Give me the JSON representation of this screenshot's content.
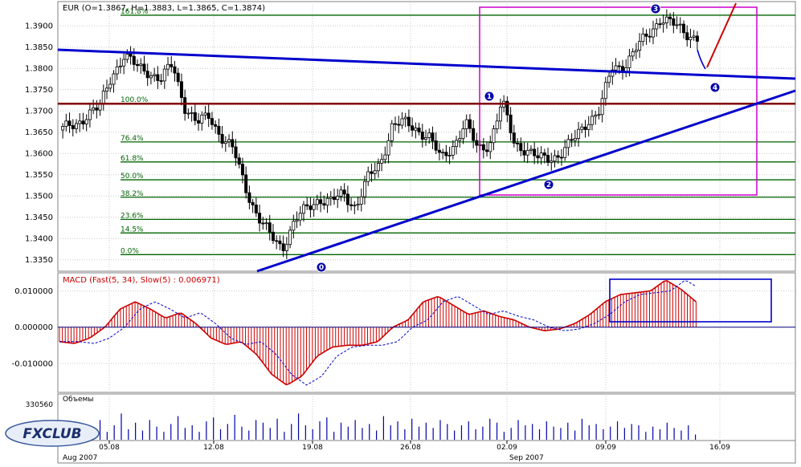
{
  "colors": {
    "background": "#ffffff",
    "grid": "#c8c8c8",
    "candle_body_up": "#ffffff",
    "candle_body_down": "#000000",
    "candle_outline": "#000000",
    "trendline": "#0000cc",
    "resistance": "#800000",
    "fibonacci": "#006400",
    "highlight_box": "#cc00cc",
    "macd_hist": "#cc0000",
    "macd_line": "#cc0000",
    "macd_signal": "#0000cc",
    "macd_box": "#0000cc",
    "volume": "#0000aa",
    "arrow_up": "#cc0000",
    "arrow_down": "#0000cc",
    "point_marker": "#0000aa"
  },
  "main_panel": {
    "title": "EUR (O=1.3867, H=1.3883, L=1.3865, C=1.3874)"
  },
  "macd_panel": {
    "title": "MACD (Fast(5, 34), Slow(5) : 0.006971)"
  },
  "volume_panel": {
    "title": "Объемы",
    "max_label": "330560"
  },
  "logo": {
    "text": "FXCLUB"
  },
  "x_axis": {
    "month_labels": [
      "Aug 2007",
      "Sep 2007"
    ],
    "date_labels": [
      "05.08",
      "12.08",
      "19.08",
      "26.08",
      "02.09",
      "09.09",
      "16.09"
    ]
  },
  "chart_data": [
    {
      "type": "candlestick",
      "title": "EUR (O=1.3867, H=1.3883, L=1.3865, C=1.3874)",
      "y_tick_labels": [
        "1.3350",
        "1.3400",
        "1.3450",
        "1.3500",
        "1.3550",
        "1.3600",
        "1.3650",
        "1.3700",
        "1.3750",
        "1.3800",
        "1.3850",
        "1.3900"
      ],
      "ylim": [
        1.3323,
        1.3957
      ],
      "grid": true,
      "x_labels": [
        "05.08",
        "12.08",
        "19.08",
        "26.08",
        "02.09",
        "09.09",
        "16.09"
      ],
      "price_path": [
        1.3655,
        1.3668,
        1.3692,
        1.3705,
        1.3785,
        1.3828,
        1.3805,
        1.3795,
        1.377,
        1.381,
        1.3712,
        1.3668,
        1.369,
        1.364,
        1.3605,
        1.352,
        1.345,
        1.3405,
        1.338,
        1.344,
        1.347,
        1.3495,
        1.3485,
        1.3505,
        1.3475,
        1.354,
        1.3575,
        1.3668,
        1.367,
        1.3658,
        1.364,
        1.3585,
        1.362,
        1.367,
        1.361,
        1.3625,
        1.372,
        1.3625,
        1.361,
        1.3585,
        1.359,
        1.3605,
        1.3635,
        1.3678,
        1.37,
        1.38,
        1.3808,
        1.3845,
        1.388,
        1.392,
        1.3902,
        1.3885,
        1.3872
      ],
      "fibonacci_levels": [
        {
          "label": "161.8%",
          "value": 1.3925
        },
        {
          "label": "100.0%",
          "value": 1.3717
        },
        {
          "label": "76.4%",
          "value": 1.3627
        },
        {
          "label": "61.8%",
          "value": 1.358
        },
        {
          "label": "50.0%",
          "value": 1.3538
        },
        {
          "label": "38.2%",
          "value": 1.3497
        },
        {
          "label": "23.6%",
          "value": 1.3445
        },
        {
          "label": "14.5%",
          "value": 1.3413
        },
        {
          "label": "0.0%",
          "value": 1.3362
        }
      ],
      "resistance_level": 1.3717,
      "wave_points": [
        "0",
        "1",
        "2",
        "3",
        "4"
      ]
    },
    {
      "type": "bar",
      "title": "MACD (Fast(5, 34), Slow(5) : 0.006971)",
      "y_tick_labels": [
        "0.010000",
        "0.000000",
        "-0.010000"
      ],
      "ylim": [
        -0.018,
        0.015
      ],
      "values": [
        -0.004,
        -0.0045,
        -0.003,
        0.0,
        0.005,
        0.007,
        0.005,
        0.0025,
        0.004,
        0.001,
        -0.003,
        -0.0048,
        -0.004,
        -0.0075,
        -0.013,
        -0.016,
        -0.0135,
        -0.008,
        -0.0055,
        -0.005,
        -0.005,
        -0.004,
        0.0,
        0.002,
        0.007,
        0.0085,
        0.006,
        0.0035,
        0.0045,
        0.003,
        0.002,
        0.0,
        -0.001,
        -0.0005,
        0.001,
        0.0035,
        0.007,
        0.009,
        0.0095,
        0.01,
        0.013,
        0.0105,
        0.007
      ]
    },
    {
      "type": "bar",
      "title": "Объемы",
      "y_tick_labels": [
        "330560"
      ],
      "ylim": [
        0,
        330560
      ],
      "values": [
        40000,
        70000,
        30000,
        120000,
        90000,
        150000,
        60000,
        110000,
        200000,
        80000,
        130000,
        70000,
        150000,
        100000,
        60000,
        120000,
        180000,
        90000,
        110000,
        60000,
        140000,
        170000,
        80000,
        120000,
        190000,
        100000,
        70000,
        150000,
        130000,
        90000,
        160000,
        60000,
        120000,
        200000,
        110000,
        80000,
        140000,
        170000,
        60000,
        130000,
        100000,
        150000,
        90000,
        120000,
        70000,
        180000,
        110000,
        140000,
        80000,
        160000,
        100000,
        130000,
        90000,
        150000,
        120000,
        70000,
        110000,
        140000,
        80000,
        100000,
        160000,
        130000,
        60000,
        90000,
        150000,
        110000,
        120000,
        80000,
        140000,
        100000,
        90000,
        130000,
        70000,
        160000,
        110000,
        120000,
        80000,
        100000,
        140000,
        90000,
        120000,
        110000,
        60000,
        100000,
        80000,
        130000,
        90000,
        70000,
        110000,
        40000
      ]
    }
  ]
}
